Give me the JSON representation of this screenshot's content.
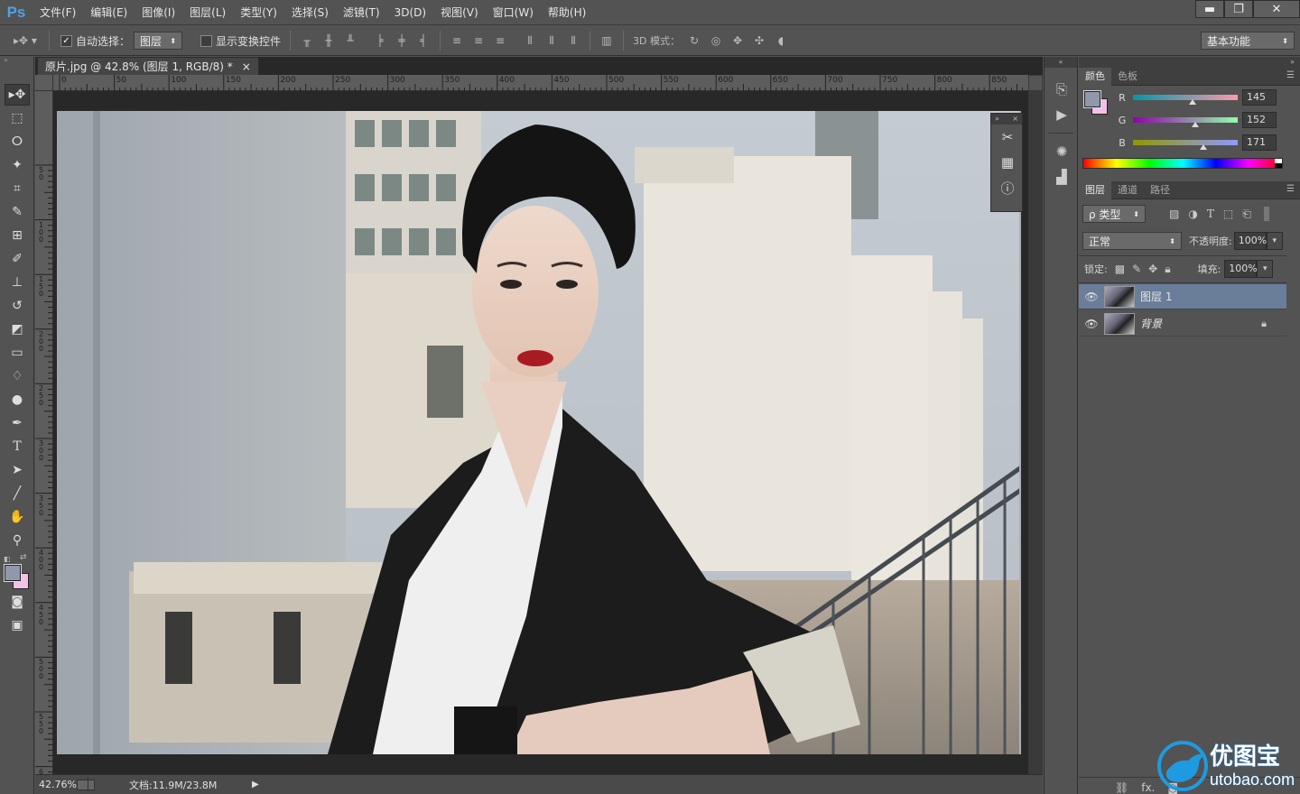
{
  "app": {
    "logo": "Ps"
  },
  "menu": [
    "文件(F)",
    "编辑(E)",
    "图像(I)",
    "图层(L)",
    "类型(Y)",
    "选择(S)",
    "滤镜(T)",
    "3D(D)",
    "视图(V)",
    "窗口(W)",
    "帮助(H)"
  ],
  "window_controls": {
    "minimize": "▬",
    "restore": "❐",
    "close": "✕"
  },
  "options": {
    "auto_select_label": "自动选择：",
    "auto_select_checked": "✓",
    "auto_select_value": "图层",
    "show_transform_label": "显示变换控件",
    "mode_3d_label": "3D 模式：",
    "workspace": "基本功能"
  },
  "document": {
    "tab_title": "原片.jpg @ 42.8% (图层 1, RGB/8) *",
    "tab_close": "×",
    "ruler_ticks": [
      "0",
      "50",
      "100",
      "150",
      "200",
      "250",
      "300",
      "350",
      "400",
      "450",
      "500",
      "550",
      "600",
      "650",
      "700",
      "750",
      "800",
      "850"
    ],
    "vruler_ticks": [
      "5 0",
      "1 0 0",
      "1 5 0",
      "2 0 0",
      "2 5 0",
      "3 0 0",
      "3 5 0",
      "4 0 0",
      "4 5 0",
      "5 0 0",
      "5 5 0",
      "6 0"
    ],
    "zoom": "42.76%",
    "doc_size": "文档:11.9M/23.8M"
  },
  "color_panel": {
    "tabs": [
      "颜色",
      "色板"
    ],
    "r_label": "R",
    "g_label": "G",
    "b_label": "B",
    "r": 145,
    "g": 152,
    "b": 171,
    "foreground_color": "#9198ab",
    "background_color": "#f2c0e8"
  },
  "layers_panel": {
    "tabs": [
      "图层",
      "通道",
      "路径"
    ],
    "filter_label": "ρ 类型",
    "blend_mode": "正常",
    "opacity_label": "不透明度:",
    "opacity": "100%",
    "lock_label": "锁定:",
    "fill_label": "填充:",
    "fill": "100%",
    "layers": [
      {
        "name": "图层 1",
        "selected": true,
        "locked": false
      },
      {
        "name": "背景",
        "selected": false,
        "locked": true
      }
    ],
    "bottom_icons": [
      "GO",
      "fx."
    ]
  },
  "watermark": {
    "cn": "优图宝",
    "url": "utobao.com"
  },
  "colors": {
    "ui_bg": "#535353",
    "selected_layer": "#6a7d99",
    "accent_blue": "#4ea3e8"
  }
}
